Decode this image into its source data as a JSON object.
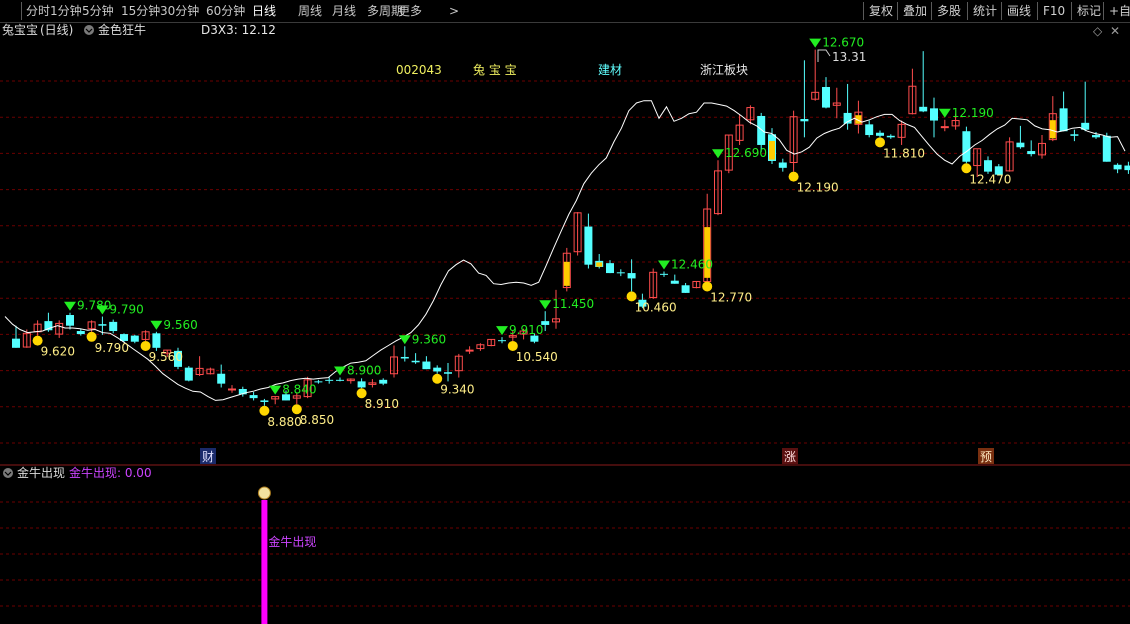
{
  "toolbar": {
    "timeframes": [
      "分时",
      "1分钟",
      "5分钟",
      "15分钟",
      "30分钟",
      "60分钟",
      "日线",
      "周线",
      "月线",
      "多周期",
      "更多"
    ],
    "active": "日线",
    "more_arrow": ">",
    "tools": [
      "复权",
      "叠加",
      "多股",
      "统计",
      "画线",
      "F10",
      "标记",
      "+自选"
    ]
  },
  "main_panel": {
    "stock_name": "兔宝宝",
    "period": "(日线)",
    "indicator_name": "金色狂牛",
    "indicator_value_label": "D3X3: 12.12",
    "info_code": "002043",
    "info_name": "兔 宝 宝",
    "info_industry": "建材",
    "info_region": "浙江板块",
    "max_label": "13.31",
    "markers": {
      "cai": "财",
      "zhang": "涨",
      "yu": "预"
    }
  },
  "sub_panel": {
    "title": "金牛出现",
    "value_label": "金牛出现: 0.00",
    "signal_label": "金牛出现",
    "signal_icon": "money-bag-icon"
  },
  "colors": {
    "up": "#ff4d4d",
    "down": "#54ffff",
    "grid": "#6b0000",
    "ma_line": "#ffffff",
    "signal_down": "#22ee22",
    "signal_dot": "#ffd700",
    "highlight_bar": "#ffcc00",
    "sub_signal": "#ff00ff"
  },
  "chart_data": {
    "type": "candlestick",
    "ylim": [
      8.2,
      13.55
    ],
    "candles": [
      {
        "o": 9.66,
        "h": 9.83,
        "l": 9.54,
        "c": 9.54
      },
      {
        "o": 9.55,
        "h": 9.78,
        "l": 9.54,
        "c": 9.73
      },
      {
        "o": 9.75,
        "h": 9.9,
        "l": 9.7,
        "c": 9.85
      },
      {
        "o": 9.89,
        "h": 10.0,
        "l": 9.75,
        "c": 9.77
      },
      {
        "o": 9.72,
        "h": 9.9,
        "l": 9.67,
        "c": 9.86
      },
      {
        "o": 9.97,
        "h": 10.0,
        "l": 9.78,
        "c": 9.83
      },
      {
        "o": 9.76,
        "h": 9.79,
        "l": 9.7,
        "c": 9.72
      },
      {
        "o": 9.79,
        "h": 9.9,
        "l": 9.75,
        "c": 9.88
      },
      {
        "o": 9.85,
        "h": 9.95,
        "l": 9.71,
        "c": 9.83
      },
      {
        "o": 9.88,
        "h": 9.91,
        "l": 9.73,
        "c": 9.76
      },
      {
        "o": 9.72,
        "h": 9.73,
        "l": 9.62,
        "c": 9.63
      },
      {
        "o": 9.7,
        "h": 9.71,
        "l": 9.6,
        "c": 9.62
      },
      {
        "o": 9.65,
        "h": 9.77,
        "l": 9.63,
        "c": 9.75
      },
      {
        "o": 9.73,
        "h": 9.75,
        "l": 9.5,
        "c": 9.54
      },
      {
        "o": 9.47,
        "h": 9.51,
        "l": 9.42,
        "c": 9.51
      },
      {
        "o": 9.5,
        "h": 9.54,
        "l": 9.26,
        "c": 9.29
      },
      {
        "o": 9.28,
        "h": 9.3,
        "l": 9.1,
        "c": 9.11
      },
      {
        "o": 9.19,
        "h": 9.43,
        "l": 9.17,
        "c": 9.27
      },
      {
        "o": 9.2,
        "h": 9.28,
        "l": 9.19,
        "c": 9.26
      },
      {
        "o": 9.2,
        "h": 9.32,
        "l": 9.02,
        "c": 9.07
      },
      {
        "o": 9.0,
        "h": 9.05,
        "l": 8.95,
        "c": 9.0
      },
      {
        "o": 9.0,
        "h": 9.03,
        "l": 8.9,
        "c": 8.93
      },
      {
        "o": 8.92,
        "h": 8.96,
        "l": 8.85,
        "c": 8.88
      },
      {
        "o": 8.85,
        "h": 8.87,
        "l": 8.78,
        "c": 8.83
      },
      {
        "o": 8.87,
        "h": 8.9,
        "l": 8.8,
        "c": 8.9
      },
      {
        "o": 8.93,
        "h": 8.98,
        "l": 8.85,
        "c": 8.85
      },
      {
        "o": 8.88,
        "h": 8.95,
        "l": 8.8,
        "c": 8.91
      },
      {
        "o": 8.9,
        "h": 9.16,
        "l": 8.88,
        "c": 9.12
      },
      {
        "o": 9.1,
        "h": 9.12,
        "l": 9.07,
        "c": 9.09
      },
      {
        "o": 9.12,
        "h": 9.16,
        "l": 9.07,
        "c": 9.11
      },
      {
        "o": 9.12,
        "h": 9.15,
        "l": 9.1,
        "c": 9.11
      },
      {
        "o": 9.11,
        "h": 9.14,
        "l": 9.07,
        "c": 9.13
      },
      {
        "o": 9.1,
        "h": 9.14,
        "l": 9.01,
        "c": 9.02
      },
      {
        "o": 9.06,
        "h": 9.13,
        "l": 9.02,
        "c": 9.08
      },
      {
        "o": 9.12,
        "h": 9.14,
        "l": 9.05,
        "c": 9.07
      },
      {
        "o": 9.2,
        "h": 9.57,
        "l": 9.15,
        "c": 9.42
      },
      {
        "o": 9.42,
        "h": 9.56,
        "l": 9.36,
        "c": 9.4
      },
      {
        "o": 9.37,
        "h": 9.47,
        "l": 9.33,
        "c": 9.35
      },
      {
        "o": 9.36,
        "h": 9.43,
        "l": 9.26,
        "c": 9.26
      },
      {
        "o": 9.28,
        "h": 9.31,
        "l": 9.2,
        "c": 9.23
      },
      {
        "o": 9.22,
        "h": 9.34,
        "l": 9.1,
        "c": 9.2
      },
      {
        "o": 9.24,
        "h": 9.46,
        "l": 9.15,
        "c": 9.43
      },
      {
        "o": 9.5,
        "h": 9.56,
        "l": 9.46,
        "c": 9.51
      },
      {
        "o": 9.53,
        "h": 9.6,
        "l": 9.5,
        "c": 9.58
      },
      {
        "o": 9.57,
        "h": 9.65,
        "l": 9.56,
        "c": 9.65
      },
      {
        "o": 9.64,
        "h": 9.68,
        "l": 9.6,
        "c": 9.63
      },
      {
        "o": 9.68,
        "h": 9.76,
        "l": 9.63,
        "c": 9.7
      },
      {
        "o": 9.72,
        "h": 9.79,
        "l": 9.65,
        "c": 9.76
      },
      {
        "o": 9.7,
        "h": 9.73,
        "l": 9.6,
        "c": 9.62
      },
      {
        "o": 9.89,
        "h": 10.02,
        "l": 9.76,
        "c": 9.84
      },
      {
        "o": 9.88,
        "h": 10.3,
        "l": 9.79,
        "c": 9.92
      },
      {
        "o": 10.33,
        "h": 10.85,
        "l": 10.28,
        "c": 10.78
      },
      {
        "o": 10.8,
        "h": 11.32,
        "l": 10.75,
        "c": 11.31
      },
      {
        "o": 11.13,
        "h": 11.3,
        "l": 10.58,
        "c": 10.63
      },
      {
        "o": 10.68,
        "h": 10.77,
        "l": 10.58,
        "c": 10.6
      },
      {
        "o": 10.65,
        "h": 10.69,
        "l": 10.52,
        "c": 10.52
      },
      {
        "o": 10.53,
        "h": 10.57,
        "l": 10.48,
        "c": 10.52
      },
      {
        "o": 10.52,
        "h": 10.7,
        "l": 10.28,
        "c": 10.45
      },
      {
        "o": 10.17,
        "h": 10.25,
        "l": 10.06,
        "c": 10.08
      },
      {
        "o": 10.2,
        "h": 10.58,
        "l": 10.18,
        "c": 10.53
      },
      {
        "o": 10.51,
        "h": 10.54,
        "l": 10.47,
        "c": 10.5
      },
      {
        "o": 10.42,
        "h": 10.5,
        "l": 10.38,
        "c": 10.38
      },
      {
        "o": 10.36,
        "h": 10.39,
        "l": 10.26,
        "c": 10.26
      },
      {
        "o": 10.33,
        "h": 10.41,
        "l": 10.32,
        "c": 10.41
      },
      {
        "o": 10.41,
        "h": 11.56,
        "l": 10.41,
        "c": 11.36
      },
      {
        "o": 11.3,
        "h": 12.0,
        "l": 11.28,
        "c": 11.86
      },
      {
        "o": 11.87,
        "h": 12.33,
        "l": 11.83,
        "c": 12.33
      },
      {
        "o": 12.26,
        "h": 12.6,
        "l": 12.2,
        "c": 12.46
      },
      {
        "o": 12.53,
        "h": 12.72,
        "l": 12.47,
        "c": 12.69
      },
      {
        "o": 12.58,
        "h": 12.62,
        "l": 12.11,
        "c": 12.2
      },
      {
        "o": 12.34,
        "h": 12.42,
        "l": 11.95,
        "c": 11.99
      },
      {
        "o": 11.97,
        "h": 12.02,
        "l": 11.85,
        "c": 11.9
      },
      {
        "o": 11.97,
        "h": 12.65,
        "l": 11.85,
        "c": 12.57
      },
      {
        "o": 12.54,
        "h": 13.31,
        "l": 12.3,
        "c": 12.51
      },
      {
        "o": 12.8,
        "h": 13.45,
        "l": 12.78,
        "c": 12.89
      },
      {
        "o": 12.96,
        "h": 13.09,
        "l": 12.68,
        "c": 12.69
      },
      {
        "o": 12.72,
        "h": 12.95,
        "l": 12.55,
        "c": 12.75
      },
      {
        "o": 12.62,
        "h": 13.0,
        "l": 12.4,
        "c": 12.48
      },
      {
        "o": 12.47,
        "h": 12.78,
        "l": 12.35,
        "c": 12.63
      },
      {
        "o": 12.47,
        "h": 12.52,
        "l": 12.3,
        "c": 12.33
      },
      {
        "o": 12.36,
        "h": 12.39,
        "l": 12.3,
        "c": 12.32
      },
      {
        "o": 12.32,
        "h": 12.34,
        "l": 12.28,
        "c": 12.3
      },
      {
        "o": 12.3,
        "h": 12.52,
        "l": 12.2,
        "c": 12.47
      },
      {
        "o": 12.61,
        "h": 13.2,
        "l": 12.6,
        "c": 12.97
      },
      {
        "o": 12.7,
        "h": 13.43,
        "l": 12.63,
        "c": 12.64
      },
      {
        "o": 12.68,
        "h": 12.82,
        "l": 12.3,
        "c": 12.52
      },
      {
        "o": 12.44,
        "h": 12.53,
        "l": 12.38,
        "c": 12.44
      },
      {
        "o": 12.45,
        "h": 12.61,
        "l": 12.4,
        "c": 12.52
      },
      {
        "o": 12.38,
        "h": 12.44,
        "l": 11.96,
        "c": 11.98
      },
      {
        "o": 11.93,
        "h": 12.14,
        "l": 11.78,
        "c": 12.15
      },
      {
        "o": 12.0,
        "h": 12.05,
        "l": 11.82,
        "c": 11.85
      },
      {
        "o": 11.92,
        "h": 11.95,
        "l": 11.81,
        "c": 11.81
      },
      {
        "o": 11.86,
        "h": 12.3,
        "l": 11.85,
        "c": 12.24
      },
      {
        "o": 12.23,
        "h": 12.45,
        "l": 12.15,
        "c": 12.17
      },
      {
        "o": 12.12,
        "h": 12.26,
        "l": 12.05,
        "c": 12.08
      },
      {
        "o": 12.07,
        "h": 12.33,
        "l": 12.02,
        "c": 12.22
      },
      {
        "o": 12.27,
        "h": 12.84,
        "l": 12.25,
        "c": 12.61
      },
      {
        "o": 12.68,
        "h": 12.9,
        "l": 12.38,
        "c": 12.38
      },
      {
        "o": 12.34,
        "h": 12.4,
        "l": 12.25,
        "c": 12.32
      },
      {
        "o": 12.49,
        "h": 13.03,
        "l": 12.38,
        "c": 12.4
      },
      {
        "o": 12.33,
        "h": 12.37,
        "l": 12.28,
        "c": 12.3
      },
      {
        "o": 12.32,
        "h": 12.36,
        "l": 11.98,
        "c": 11.98
      },
      {
        "o": 11.94,
        "h": 11.96,
        "l": 11.83,
        "c": 11.88
      },
      {
        "o": 11.93,
        "h": 11.98,
        "l": 11.82,
        "c": 11.87
      },
      {
        "o": 11.8,
        "h": 12.62,
        "l": 11.8,
        "c": 12.55
      }
    ],
    "ma": [
      9.95,
      9.85,
      9.78,
      9.74,
      9.75,
      9.76,
      9.8,
      9.83,
      9.8,
      9.8,
      9.79,
      9.77,
      9.78,
      9.74,
      9.73,
      9.67,
      9.6,
      9.53,
      9.46,
      9.39,
      9.3,
      9.2,
      9.13,
      9.06,
      9.01,
      8.97,
      8.96,
      8.9,
      8.85,
      8.86,
      8.89,
      8.92,
      8.95,
      8.97,
      9.0,
      9.02,
      9.06,
      9.08,
      9.11,
      9.13,
      9.14,
      9.13,
      9.14,
      9.15,
      9.23,
      9.29,
      9.34,
      9.35,
      9.37,
      9.44,
      9.51,
      9.57,
      9.63,
      9.68,
      9.74,
      9.84,
      9.98,
      10.16,
      10.37,
      10.55,
      10.63,
      10.69,
      10.64,
      10.52,
      10.49,
      10.38,
      10.37,
      10.39,
      10.4,
      10.39,
      10.36,
      10.4,
      10.62,
      10.85,
      11.07,
      11.29,
      11.47,
      11.69,
      11.83,
      11.94,
      12.03,
      12.24,
      12.42,
      12.65,
      12.75,
      12.78,
      12.78,
      12.55,
      12.7,
      12.51,
      12.55,
      12.61,
      12.63,
      12.75,
      12.75,
      12.73,
      12.71,
      12.65,
      12.58,
      12.5,
      12.45,
      12.37,
      12.35,
      12.27,
      12.13,
      12.08,
      12.11,
      12.17,
      12.29,
      12.35,
      12.39,
      12.42,
      12.5,
      12.55,
      12.5,
      12.53,
      12.57,
      12.6,
      12.6,
      12.52,
      12.47,
      12.43,
      12.31,
      12.19,
      12.08,
      12.0,
      11.95,
      12.05,
      12.12,
      12.2,
      12.26,
      12.34,
      12.41,
      12.46,
      12.55,
      12.54,
      12.53,
      12.45,
      12.41,
      12.4,
      12.37,
      12.39,
      12.42,
      12.43,
      12.38,
      12.35,
      12.33,
      12.3,
      12.31,
      12.12
    ],
    "highlight_bars": [
      51,
      54,
      64,
      70,
      78,
      96,
      109
    ],
    "signal_triangles": [
      {
        "i": 5,
        "label": "9.780"
      },
      {
        "i": 8,
        "label": "9.790"
      },
      {
        "i": 13,
        "label": "9.560"
      },
      {
        "i": 24,
        "label": "8.840"
      },
      {
        "i": 30,
        "label": "8.900"
      },
      {
        "i": 36,
        "label": "9.360"
      },
      {
        "i": 45,
        "label": "9.910"
      },
      {
        "i": 49,
        "label": "11.450"
      },
      {
        "i": 60,
        "label": "12.460"
      },
      {
        "i": 65,
        "label": "12.690"
      },
      {
        "i": 74,
        "label": "12.670"
      },
      {
        "i": 86,
        "label": "12.190"
      }
    ],
    "signal_dots": [
      {
        "i": 2,
        "label": "9.620"
      },
      {
        "i": 7,
        "label": "9.790"
      },
      {
        "i": 12,
        "label": "9.560"
      },
      {
        "i": 23,
        "label": "8.880"
      },
      {
        "i": 26,
        "label": "8.850"
      },
      {
        "i": 32,
        "label": "8.910"
      },
      {
        "i": 39,
        "label": "9.340"
      },
      {
        "i": 46,
        "label": "10.540"
      },
      {
        "i": 57,
        "label": "10.460"
      },
      {
        "i": 64,
        "label": "12.770"
      },
      {
        "i": 72,
        "label": "12.190"
      },
      {
        "i": 80,
        "label": "11.810"
      },
      {
        "i": 88,
        "label": "12.470"
      }
    ],
    "sub_signal_index": 23
  }
}
